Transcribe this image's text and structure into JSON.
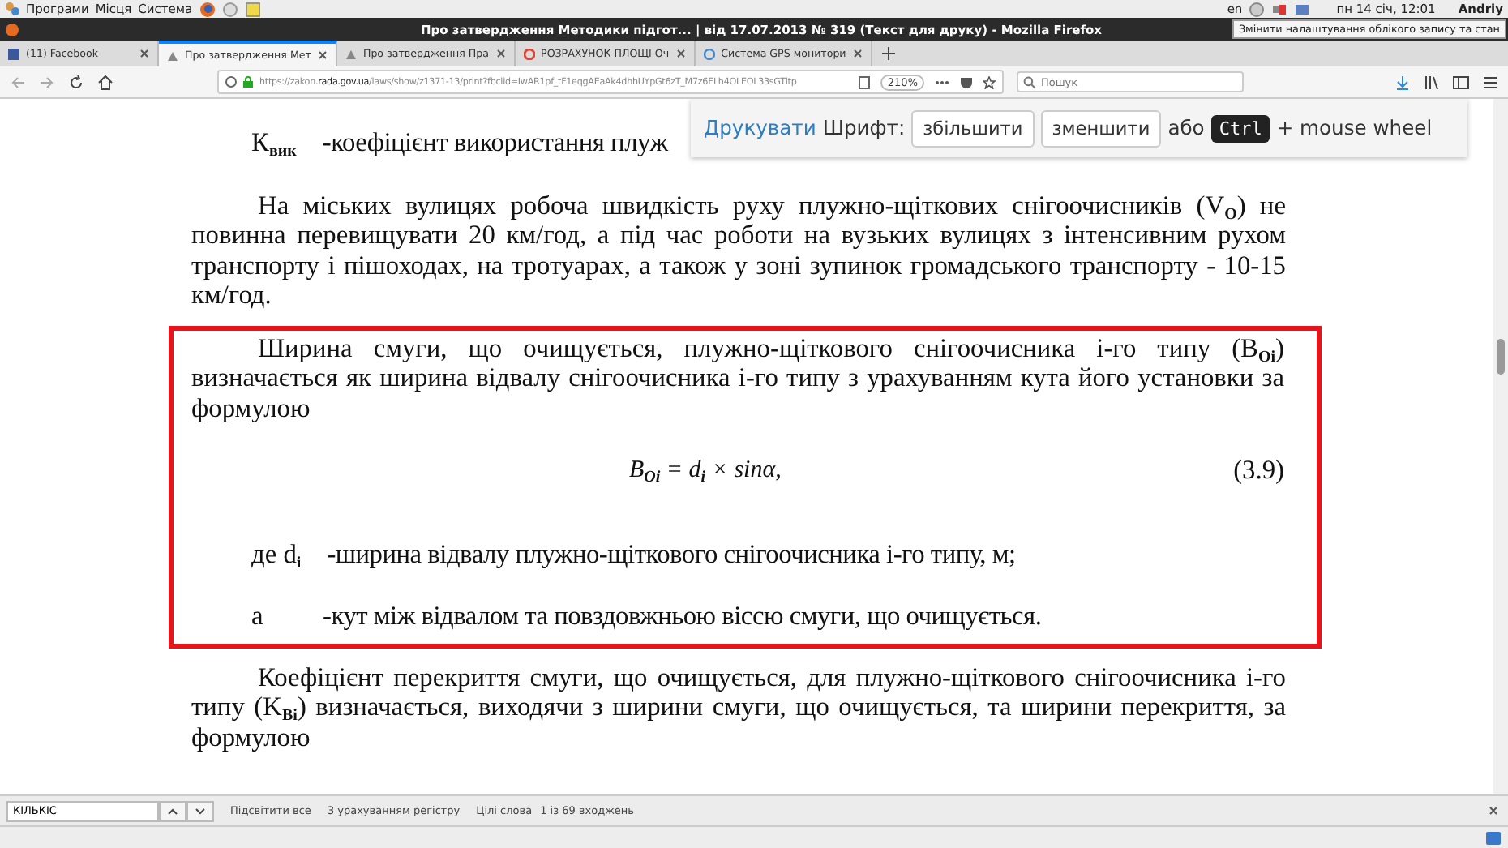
{
  "top_panel": {
    "menus": [
      "Програми",
      "Місця",
      "Система"
    ],
    "keyboard": "en",
    "datetime": "пн 14 січ, 12:01",
    "user": "Andriy"
  },
  "title_bar": {
    "title": "Про затвердження Методики підгот... | від 17.07.2013 № 319 (Текст для друку) - Mozilla Firefox"
  },
  "tooltip": "Змінити налаштування облікого запису та стан",
  "tabs": [
    {
      "label": "(11) Facebook",
      "selected": false
    },
    {
      "label": "Про затвердження Мет",
      "selected": true
    },
    {
      "label": "Про затвердження Пра",
      "selected": false
    },
    {
      "label": "РОЗРАХУНОК ПЛОЩІ Оч",
      "selected": false
    },
    {
      "label": "Система GPS монитори",
      "selected": false
    }
  ],
  "nav_bar": {
    "url": "https://zakon.**rada.gov.ua**/laws/show/z1371-13/print?fbclid=IwAR1pf_tF1eqgAEaAk4dhhUYpGt6zT_M7z6ELh4OLEOL33sGTltp",
    "zoom": "210%",
    "search_placeholder": "Пошук"
  },
  "print_bar": {
    "print_link": "Друкувати",
    "font_label": "Шрифт:",
    "buttons": [
      "збільшити",
      "зменшити"
    ],
    "or": "або",
    "key": "Ctrl",
    "suffix": "+ mouse wheel"
  },
  "document": [
    {
      "kind": "definition",
      "symbol": "К$_{вик}$",
      "text": "-коефіцієнт використання плуж"
    },
    {
      "kind": "paragraph",
      "text": "На міських вулицях робоча швидкість руху плужно-щіткових снігоочисників (V$_{O}$) не повинна перевищувати 20 км/год, а під час роботи на вузьких вулицях з інтенсивним рухом транспорту і пішоходах, на тротуарах, а також у зоні зупинок громадського транспорту - 10-15 км/год."
    },
    {
      "kind": "highlight",
      "children": [
        {
          "kind": "paragraph",
          "text": "Ширина смуги, що очищується, плужно-щіткового снігоочисника і-го типу (B$_{Oi}$) визначається як ширина відвалу снігоочисника і-го типу з урахуванням кута його установки за формулою"
        },
        {
          "kind": "formula",
          "text": "B$_{Oi}$ = d$_{i}$ × sinα,",
          "number": "(3.9)"
        },
        {
          "kind": "definition",
          "symbol": "де d$_{i}$",
          "text": "-ширина відвалу плужно-щіткового снігоочисника і-го типу, м;"
        },
        {
          "kind": "definition",
          "symbol": "a",
          "text": "-кут між відвалом та повздовжньою віссю смуги, що очищується."
        }
      ]
    },
    {
      "kind": "paragraph",
      "text": "Коефіцієнт перекриття смуги, що очищується, для плужно-щіткового снігоочисника і-го типу (K$_{Bi}$) визначається, виходячи з ширини смуги, що очищується, та ширини перекриття, за формулою"
    }
  ],
  "find_bar": {
    "value": "КІЛЬКІС",
    "options": [
      "Підсвітити все",
      "З урахуванням регістру",
      "Цілі слова"
    ],
    "status": "1 із 69 входжень"
  }
}
